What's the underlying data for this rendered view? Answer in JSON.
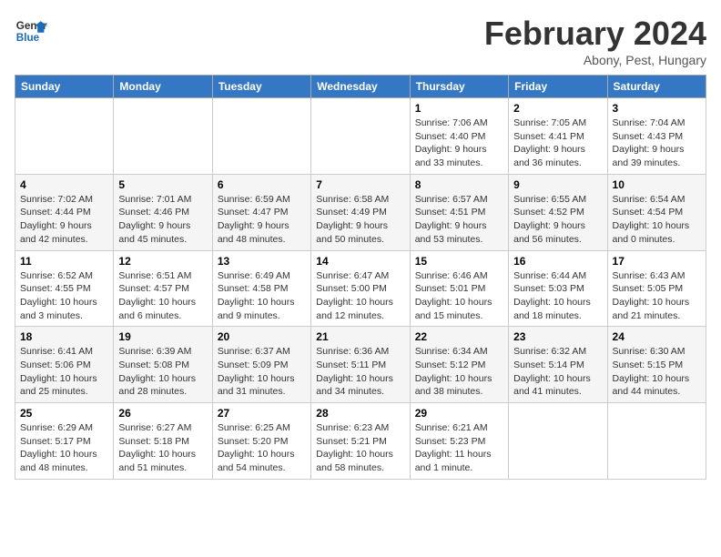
{
  "header": {
    "logo_line1": "General",
    "logo_line2": "Blue",
    "month": "February 2024",
    "location": "Abony, Pest, Hungary"
  },
  "weekdays": [
    "Sunday",
    "Monday",
    "Tuesday",
    "Wednesday",
    "Thursday",
    "Friday",
    "Saturday"
  ],
  "weeks": [
    [
      {
        "day": "",
        "sunrise": "",
        "sunset": "",
        "daylight": ""
      },
      {
        "day": "",
        "sunrise": "",
        "sunset": "",
        "daylight": ""
      },
      {
        "day": "",
        "sunrise": "",
        "sunset": "",
        "daylight": ""
      },
      {
        "day": "",
        "sunrise": "",
        "sunset": "",
        "daylight": ""
      },
      {
        "day": "1",
        "sunrise": "Sunrise: 7:06 AM",
        "sunset": "Sunset: 4:40 PM",
        "daylight": "Daylight: 9 hours and 33 minutes."
      },
      {
        "day": "2",
        "sunrise": "Sunrise: 7:05 AM",
        "sunset": "Sunset: 4:41 PM",
        "daylight": "Daylight: 9 hours and 36 minutes."
      },
      {
        "day": "3",
        "sunrise": "Sunrise: 7:04 AM",
        "sunset": "Sunset: 4:43 PM",
        "daylight": "Daylight: 9 hours and 39 minutes."
      }
    ],
    [
      {
        "day": "4",
        "sunrise": "Sunrise: 7:02 AM",
        "sunset": "Sunset: 4:44 PM",
        "daylight": "Daylight: 9 hours and 42 minutes."
      },
      {
        "day": "5",
        "sunrise": "Sunrise: 7:01 AM",
        "sunset": "Sunset: 4:46 PM",
        "daylight": "Daylight: 9 hours and 45 minutes."
      },
      {
        "day": "6",
        "sunrise": "Sunrise: 6:59 AM",
        "sunset": "Sunset: 4:47 PM",
        "daylight": "Daylight: 9 hours and 48 minutes."
      },
      {
        "day": "7",
        "sunrise": "Sunrise: 6:58 AM",
        "sunset": "Sunset: 4:49 PM",
        "daylight": "Daylight: 9 hours and 50 minutes."
      },
      {
        "day": "8",
        "sunrise": "Sunrise: 6:57 AM",
        "sunset": "Sunset: 4:51 PM",
        "daylight": "Daylight: 9 hours and 53 minutes."
      },
      {
        "day": "9",
        "sunrise": "Sunrise: 6:55 AM",
        "sunset": "Sunset: 4:52 PM",
        "daylight": "Daylight: 9 hours and 56 minutes."
      },
      {
        "day": "10",
        "sunrise": "Sunrise: 6:54 AM",
        "sunset": "Sunset: 4:54 PM",
        "daylight": "Daylight: 10 hours and 0 minutes."
      }
    ],
    [
      {
        "day": "11",
        "sunrise": "Sunrise: 6:52 AM",
        "sunset": "Sunset: 4:55 PM",
        "daylight": "Daylight: 10 hours and 3 minutes."
      },
      {
        "day": "12",
        "sunrise": "Sunrise: 6:51 AM",
        "sunset": "Sunset: 4:57 PM",
        "daylight": "Daylight: 10 hours and 6 minutes."
      },
      {
        "day": "13",
        "sunrise": "Sunrise: 6:49 AM",
        "sunset": "Sunset: 4:58 PM",
        "daylight": "Daylight: 10 hours and 9 minutes."
      },
      {
        "day": "14",
        "sunrise": "Sunrise: 6:47 AM",
        "sunset": "Sunset: 5:00 PM",
        "daylight": "Daylight: 10 hours and 12 minutes."
      },
      {
        "day": "15",
        "sunrise": "Sunrise: 6:46 AM",
        "sunset": "Sunset: 5:01 PM",
        "daylight": "Daylight: 10 hours and 15 minutes."
      },
      {
        "day": "16",
        "sunrise": "Sunrise: 6:44 AM",
        "sunset": "Sunset: 5:03 PM",
        "daylight": "Daylight: 10 hours and 18 minutes."
      },
      {
        "day": "17",
        "sunrise": "Sunrise: 6:43 AM",
        "sunset": "Sunset: 5:05 PM",
        "daylight": "Daylight: 10 hours and 21 minutes."
      }
    ],
    [
      {
        "day": "18",
        "sunrise": "Sunrise: 6:41 AM",
        "sunset": "Sunset: 5:06 PM",
        "daylight": "Daylight: 10 hours and 25 minutes."
      },
      {
        "day": "19",
        "sunrise": "Sunrise: 6:39 AM",
        "sunset": "Sunset: 5:08 PM",
        "daylight": "Daylight: 10 hours and 28 minutes."
      },
      {
        "day": "20",
        "sunrise": "Sunrise: 6:37 AM",
        "sunset": "Sunset: 5:09 PM",
        "daylight": "Daylight: 10 hours and 31 minutes."
      },
      {
        "day": "21",
        "sunrise": "Sunrise: 6:36 AM",
        "sunset": "Sunset: 5:11 PM",
        "daylight": "Daylight: 10 hours and 34 minutes."
      },
      {
        "day": "22",
        "sunrise": "Sunrise: 6:34 AM",
        "sunset": "Sunset: 5:12 PM",
        "daylight": "Daylight: 10 hours and 38 minutes."
      },
      {
        "day": "23",
        "sunrise": "Sunrise: 6:32 AM",
        "sunset": "Sunset: 5:14 PM",
        "daylight": "Daylight: 10 hours and 41 minutes."
      },
      {
        "day": "24",
        "sunrise": "Sunrise: 6:30 AM",
        "sunset": "Sunset: 5:15 PM",
        "daylight": "Daylight: 10 hours and 44 minutes."
      }
    ],
    [
      {
        "day": "25",
        "sunrise": "Sunrise: 6:29 AM",
        "sunset": "Sunset: 5:17 PM",
        "daylight": "Daylight: 10 hours and 48 minutes."
      },
      {
        "day": "26",
        "sunrise": "Sunrise: 6:27 AM",
        "sunset": "Sunset: 5:18 PM",
        "daylight": "Daylight: 10 hours and 51 minutes."
      },
      {
        "day": "27",
        "sunrise": "Sunrise: 6:25 AM",
        "sunset": "Sunset: 5:20 PM",
        "daylight": "Daylight: 10 hours and 54 minutes."
      },
      {
        "day": "28",
        "sunrise": "Sunrise: 6:23 AM",
        "sunset": "Sunset: 5:21 PM",
        "daylight": "Daylight: 10 hours and 58 minutes."
      },
      {
        "day": "29",
        "sunrise": "Sunrise: 6:21 AM",
        "sunset": "Sunset: 5:23 PM",
        "daylight": "Daylight: 11 hours and 1 minute."
      },
      {
        "day": "",
        "sunrise": "",
        "sunset": "",
        "daylight": ""
      },
      {
        "day": "",
        "sunrise": "",
        "sunset": "",
        "daylight": ""
      }
    ]
  ]
}
